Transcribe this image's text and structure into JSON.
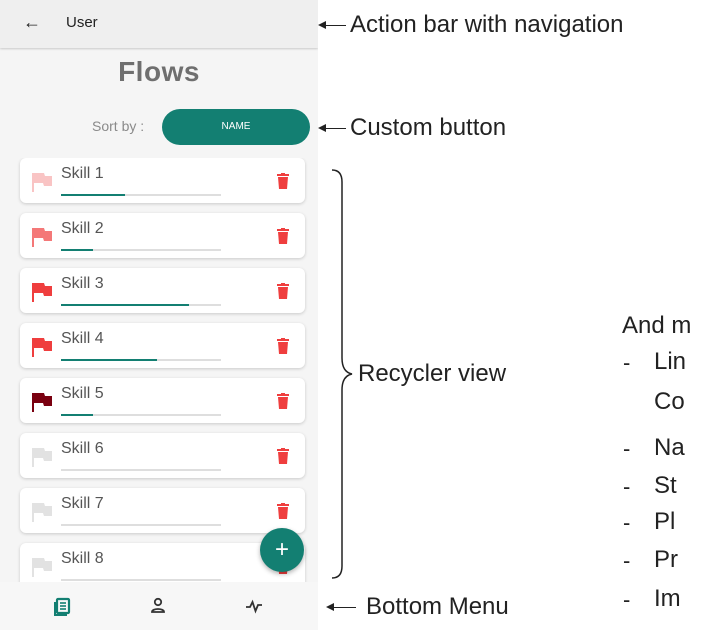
{
  "appbar": {
    "back_icon": "arrow-left-icon",
    "title": "User"
  },
  "page_title": "Flows",
  "sort": {
    "label": "Sort by :",
    "button": "NAME"
  },
  "skills": [
    {
      "name": "Skill 1",
      "flag_color": "#f9c4c4",
      "progress": 0.4
    },
    {
      "name": "Skill 2",
      "flag_color": "#f47878",
      "progress": 0.2
    },
    {
      "name": "Skill 3",
      "flag_color": "#ef3e3e",
      "progress": 0.8
    },
    {
      "name": "Skill 4",
      "flag_color": "#ef3e3e",
      "progress": 0.6
    },
    {
      "name": "Skill 5",
      "flag_color": "#7a0010",
      "progress": 0.2
    },
    {
      "name": "Skill 6",
      "flag_color": "#e2e2e2",
      "progress": 0.0
    },
    {
      "name": "Skill 7",
      "flag_color": "#e2e2e2",
      "progress": 0.0
    },
    {
      "name": "Skill 8",
      "flag_color": "#e2e2e2",
      "progress": 0.0
    }
  ],
  "fab_label": "+",
  "bottom_nav": [
    {
      "icon": "list-icon",
      "color": "#137f72"
    },
    {
      "icon": "person-icon",
      "color": "#333333"
    },
    {
      "icon": "activity-icon",
      "color": "#333333"
    }
  ],
  "annotations": {
    "action_bar": "Action bar with navigation",
    "custom_button": "Custom button",
    "recycler": "Recycler view",
    "bottom_menu": "Bottom Menu"
  },
  "more": {
    "heading": "And m",
    "items": [
      "Lin",
      "Co",
      "Na",
      "St",
      "Pl",
      "Pr",
      "Im"
    ]
  },
  "colors": {
    "accent": "#137f72",
    "delete": "#ef3e3e"
  }
}
